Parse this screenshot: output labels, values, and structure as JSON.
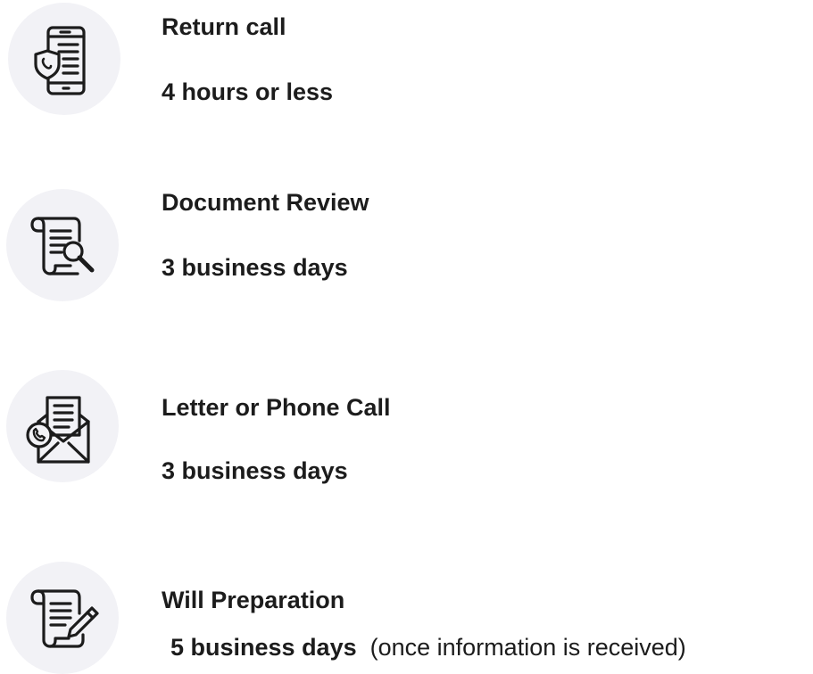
{
  "items": [
    {
      "title": "Return call",
      "time": "4 hours or less",
      "note": "",
      "icon": "smartphone-shield-icon"
    },
    {
      "title": "Document Review",
      "time": "3 business days",
      "note": "",
      "icon": "scroll-magnifier-icon"
    },
    {
      "title": "Letter or Phone Call",
      "time": "3 business days",
      "note": "",
      "icon": "envelope-phone-icon"
    },
    {
      "title": "Will Preparation",
      "time": "5 business days",
      "note": "(once information is received)",
      "icon": "scroll-pen-icon"
    }
  ],
  "colors": {
    "icon_background": "#f2f2f6",
    "icon_stroke": "#1c1c1c",
    "text": "#1c1c1c"
  }
}
